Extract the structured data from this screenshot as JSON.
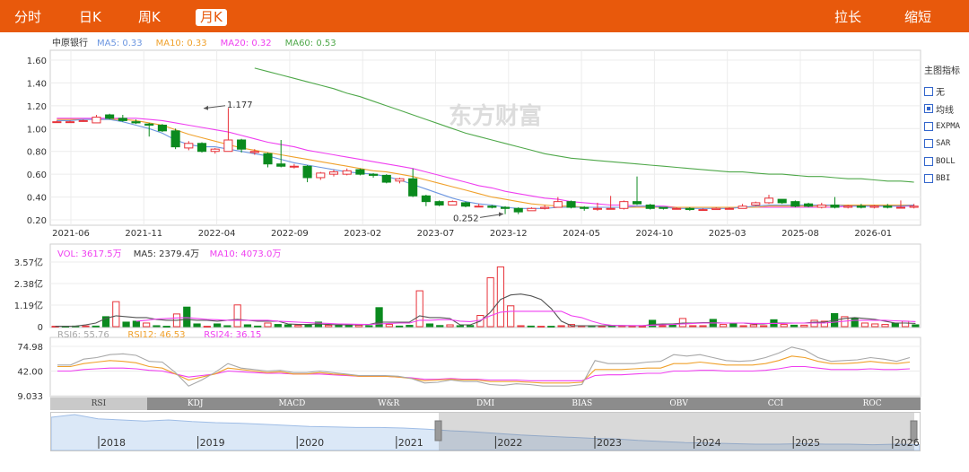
{
  "tabs": [
    {
      "label": "分时",
      "active": false
    },
    {
      "label": "日K",
      "active": false
    },
    {
      "label": "周K",
      "active": false
    },
    {
      "label": "月K",
      "active": true
    }
  ],
  "actions": {
    "stretch": "拉长",
    "shrink": "缩短"
  },
  "watermark": "东方财富",
  "indicator_panel": {
    "title": "主图指标",
    "items": [
      {
        "label": "无",
        "checked": false
      },
      {
        "label": "均线",
        "checked": true
      },
      {
        "label": "EXPMA",
        "checked": false
      },
      {
        "label": "SAR",
        "checked": false
      },
      {
        "label": "BOLL",
        "checked": false
      },
      {
        "label": "BBI",
        "checked": false
      }
    ]
  },
  "indicator_tabs": [
    {
      "label": "RSI",
      "active": true
    },
    {
      "label": "KDJ",
      "active": false
    },
    {
      "label": "MACD",
      "active": false
    },
    {
      "label": "W&R",
      "active": false
    },
    {
      "label": "DMI",
      "active": false
    },
    {
      "label": "BIAS",
      "active": false
    },
    {
      "label": "OBV",
      "active": false
    },
    {
      "label": "CCI",
      "active": false
    },
    {
      "label": "ROC",
      "active": false
    }
  ],
  "navigator": {
    "years": [
      "2018",
      "2019",
      "2020",
      "2021",
      "2022",
      "2023",
      "2024",
      "2025",
      "2026"
    ]
  },
  "colors": {
    "up": "#e8333a",
    "down": "#0a8a1e",
    "ma5": "#6c96e0",
    "ma10": "#f0a12c",
    "ma20": "#ef3ff0",
    "ma60": "#4fa84a",
    "rsi6": "#a8a8a8",
    "rsi12": "#f0a12c",
    "rsi24": "#ef3ff0",
    "brand": "#e8590c"
  },
  "chart_data": [
    {
      "type": "candlestick",
      "title": "中原银行",
      "legend": [
        {
          "name": "MA5",
          "value": "0.33",
          "color": "#6c96e0"
        },
        {
          "name": "MA10",
          "value": "0.33",
          "color": "#f0a12c"
        },
        {
          "name": "MA20",
          "value": "0.32",
          "color": "#ef3ff0"
        },
        {
          "name": "MA60",
          "value": "0.53",
          "color": "#4fa84a"
        }
      ],
      "ylim": [
        0.2,
        1.6
      ],
      "yticks": [
        "1.60",
        "1.40",
        "1.20",
        "1.00",
        "0.80",
        "0.60",
        "0.40",
        "0.20"
      ],
      "xticks": [
        "2021-06",
        "2021-11",
        "2022-04",
        "2022-09",
        "2023-02",
        "2023-07",
        "2023-12",
        "2024-05",
        "2024-10",
        "2025-03",
        "2025-08",
        "2026-01"
      ],
      "annotations": [
        {
          "text": "1.177",
          "index": 11,
          "value": 1.177
        },
        {
          "text": "0.252",
          "index": 34,
          "value": 0.252
        }
      ],
      "candles": [
        [
          1.06,
          1.06,
          1.07,
          1.05
        ],
        [
          1.06,
          1.06,
          1.07,
          1.05
        ],
        [
          1.07,
          1.07,
          1.08,
          1.06
        ],
        [
          1.05,
          1.1,
          1.12,
          1.05
        ],
        [
          1.12,
          1.09,
          1.13,
          1.08
        ],
        [
          1.09,
          1.07,
          1.12,
          1.06
        ],
        [
          1.06,
          1.05,
          1.08,
          1.04
        ],
        [
          1.04,
          1.03,
          1.05,
          0.93
        ],
        [
          1.03,
          0.98,
          1.04,
          0.97
        ],
        [
          0.98,
          0.84,
          1.0,
          0.82
        ],
        [
          0.83,
          0.87,
          0.89,
          0.81
        ],
        [
          0.87,
          0.8,
          0.88,
          0.79
        ],
        [
          0.8,
          0.82,
          0.83,
          0.78
        ],
        [
          0.8,
          0.9,
          1.18,
          0.8
        ],
        [
          0.9,
          0.82,
          0.91,
          0.79
        ],
        [
          0.79,
          0.8,
          0.82,
          0.77
        ],
        [
          0.78,
          0.69,
          0.79,
          0.66
        ],
        [
          0.69,
          0.67,
          0.9,
          0.66
        ],
        [
          0.67,
          0.67,
          0.69,
          0.65
        ],
        [
          0.67,
          0.57,
          0.68,
          0.53
        ],
        [
          0.57,
          0.61,
          0.62,
          0.55
        ],
        [
          0.6,
          0.62,
          0.64,
          0.58
        ],
        [
          0.6,
          0.63,
          0.65,
          0.59
        ],
        [
          0.64,
          0.6,
          0.65,
          0.59
        ],
        [
          0.6,
          0.59,
          0.61,
          0.57
        ],
        [
          0.59,
          0.53,
          0.6,
          0.52
        ],
        [
          0.54,
          0.56,
          0.57,
          0.52
        ],
        [
          0.56,
          0.41,
          0.65,
          0.4
        ],
        [
          0.41,
          0.36,
          0.42,
          0.32
        ],
        [
          0.36,
          0.33,
          0.37,
          0.32
        ],
        [
          0.33,
          0.36,
          0.37,
          0.33
        ],
        [
          0.35,
          0.32,
          0.36,
          0.31
        ],
        [
          0.32,
          0.32,
          0.34,
          0.31
        ],
        [
          0.32,
          0.31,
          0.33,
          0.3
        ],
        [
          0.31,
          0.3,
          0.32,
          0.25
        ],
        [
          0.3,
          0.27,
          0.31,
          0.25
        ],
        [
          0.28,
          0.3,
          0.31,
          0.28
        ],
        [
          0.3,
          0.31,
          0.33,
          0.29
        ],
        [
          0.31,
          0.36,
          0.4,
          0.31
        ],
        [
          0.36,
          0.31,
          0.37,
          0.3
        ],
        [
          0.31,
          0.3,
          0.32,
          0.28
        ],
        [
          0.3,
          0.3,
          0.35,
          0.28
        ],
        [
          0.3,
          0.3,
          0.41,
          0.29
        ],
        [
          0.3,
          0.36,
          0.37,
          0.29
        ],
        [
          0.36,
          0.34,
          0.58,
          0.33
        ],
        [
          0.33,
          0.3,
          0.34,
          0.29
        ],
        [
          0.31,
          0.3,
          0.31,
          0.29
        ],
        [
          0.3,
          0.3,
          0.31,
          0.29
        ],
        [
          0.3,
          0.29,
          0.31,
          0.28
        ],
        [
          0.29,
          0.29,
          0.3,
          0.28
        ],
        [
          0.29,
          0.3,
          0.31,
          0.29
        ],
        [
          0.3,
          0.3,
          0.31,
          0.29
        ],
        [
          0.3,
          0.32,
          0.34,
          0.3
        ],
        [
          0.33,
          0.35,
          0.36,
          0.32
        ],
        [
          0.35,
          0.39,
          0.42,
          0.34
        ],
        [
          0.38,
          0.35,
          0.36,
          0.34
        ],
        [
          0.36,
          0.32,
          0.37,
          0.31
        ],
        [
          0.34,
          0.32,
          0.35,
          0.31
        ],
        [
          0.31,
          0.33,
          0.35,
          0.3
        ],
        [
          0.33,
          0.31,
          0.4,
          0.3
        ],
        [
          0.31,
          0.32,
          0.33,
          0.3
        ],
        [
          0.32,
          0.31,
          0.34,
          0.3
        ],
        [
          0.31,
          0.32,
          0.33,
          0.3
        ],
        [
          0.32,
          0.31,
          0.34,
          0.3
        ],
        [
          0.31,
          0.31,
          0.37,
          0.3
        ],
        [
          0.31,
          0.32,
          0.34,
          0.3
        ]
      ],
      "ma5": [
        1.07,
        1.07,
        1.08,
        1.08,
        1.08,
        1.06,
        1.03,
        1.0,
        0.96,
        0.9,
        0.86,
        0.84,
        0.84,
        0.82,
        0.8,
        0.78,
        0.76,
        0.73,
        0.7,
        0.68,
        0.66,
        0.64,
        0.62,
        0.61,
        0.6,
        0.58,
        0.55,
        0.51,
        0.47,
        0.43,
        0.39,
        0.36,
        0.34,
        0.33,
        0.31,
        0.3,
        0.3,
        0.3,
        0.31,
        0.31,
        0.31,
        0.31,
        0.31,
        0.31,
        0.32,
        0.32,
        0.31,
        0.3,
        0.3,
        0.3,
        0.3,
        0.3,
        0.31,
        0.32,
        0.33,
        0.33,
        0.33,
        0.33,
        0.33,
        0.33,
        0.32,
        0.32,
        0.32,
        0.32,
        0.32,
        0.33
      ],
      "ma10": [
        1.08,
        1.08,
        1.08,
        1.08,
        1.08,
        1.08,
        1.07,
        1.05,
        1.03,
        0.99,
        0.95,
        0.92,
        0.89,
        0.86,
        0.83,
        0.81,
        0.79,
        0.77,
        0.75,
        0.73,
        0.71,
        0.69,
        0.67,
        0.65,
        0.63,
        0.62,
        0.6,
        0.58,
        0.55,
        0.52,
        0.49,
        0.46,
        0.43,
        0.4,
        0.38,
        0.36,
        0.34,
        0.33,
        0.32,
        0.32,
        0.31,
        0.31,
        0.31,
        0.31,
        0.31,
        0.31,
        0.31,
        0.31,
        0.31,
        0.31,
        0.31,
        0.31,
        0.31,
        0.31,
        0.32,
        0.32,
        0.32,
        0.32,
        0.32,
        0.33,
        0.33,
        0.33,
        0.33,
        0.33,
        0.33,
        0.33
      ],
      "ma20": [
        1.09,
        1.09,
        1.09,
        1.09,
        1.09,
        1.09,
        1.09,
        1.08,
        1.07,
        1.05,
        1.03,
        1.01,
        0.99,
        0.97,
        0.94,
        0.91,
        0.88,
        0.86,
        0.84,
        0.81,
        0.79,
        0.77,
        0.75,
        0.73,
        0.71,
        0.69,
        0.67,
        0.65,
        0.62,
        0.59,
        0.56,
        0.53,
        0.5,
        0.48,
        0.45,
        0.43,
        0.41,
        0.39,
        0.38,
        0.36,
        0.35,
        0.34,
        0.33,
        0.33,
        0.32,
        0.32,
        0.32,
        0.31,
        0.31,
        0.31,
        0.31,
        0.31,
        0.31,
        0.31,
        0.31,
        0.31,
        0.31,
        0.31,
        0.31,
        0.31,
        0.32,
        0.32,
        0.32,
        0.32,
        0.32,
        0.32
      ],
      "ma60": [
        null,
        null,
        null,
        null,
        null,
        null,
        null,
        null,
        null,
        null,
        null,
        null,
        null,
        null,
        null,
        1.53,
        1.5,
        1.47,
        1.44,
        1.41,
        1.38,
        1.35,
        1.31,
        1.28,
        1.24,
        1.2,
        1.16,
        1.12,
        1.08,
        1.04,
        1.0,
        0.96,
        0.93,
        0.9,
        0.87,
        0.84,
        0.81,
        0.78,
        0.76,
        0.74,
        0.73,
        0.72,
        0.71,
        0.7,
        0.69,
        0.68,
        0.67,
        0.66,
        0.65,
        0.64,
        0.63,
        0.62,
        0.62,
        0.61,
        0.6,
        0.6,
        0.59,
        0.58,
        0.58,
        0.57,
        0.56,
        0.56,
        0.55,
        0.54,
        0.54,
        0.53
      ]
    },
    {
      "type": "bar",
      "legend": [
        {
          "name": "VOL",
          "value": "3617.5万",
          "color": "#ef3ff0"
        },
        {
          "name": "MA5",
          "value": "2379.4万",
          "color": "#333333"
        },
        {
          "name": "MA10",
          "value": "4073.0万",
          "color": "#ef3ff0"
        }
      ],
      "yticks": [
        "3.57亿",
        "2.38亿",
        "1.19亿",
        "0"
      ],
      "ylim": [
        0,
        3.57
      ],
      "values": [
        0.02,
        0.02,
        0.03,
        0.04,
        0.03,
        0.55,
        1.38,
        0.25,
        0.3,
        0.2,
        0.05,
        0.02,
        0.7,
        1.08,
        0.15,
        0.02,
        0.15,
        0.05,
        1.2,
        0.1,
        0.03,
        0.2,
        0.12,
        0.1,
        0.08,
        0.08,
        0.25,
        0.08,
        0.1,
        0.05,
        0.08,
        0.05,
        1.05,
        0.12,
        0.03,
        0.07,
        1.98,
        0.15,
        0.06,
        0.1,
        0.05,
        0.06,
        0.62,
        2.7,
        3.3,
        1.15,
        0.05,
        0.03,
        0.02,
        0.02,
        0.05,
        0.12,
        0.04,
        0.05,
        0.03,
        0.05,
        0.04,
        0.03,
        0.02,
        0.35,
        0.05,
        0.1,
        0.45,
        0.05,
        0.05,
        0.4,
        0.12,
        0.18,
        0.05,
        0.1,
        0.05,
        0.38,
        0.12,
        0.08,
        0.08,
        0.35,
        0.3,
        0.72,
        0.55,
        0.45,
        0.2,
        0.15,
        0.12,
        0.2,
        0.3,
        0.1
      ],
      "ma5": [
        0.02,
        0.02,
        0.03,
        0.1,
        0.2,
        0.45,
        0.6,
        0.55,
        0.5,
        0.5,
        0.4,
        0.35,
        0.35,
        0.4,
        0.35,
        0.35,
        0.3,
        0.35,
        0.4,
        0.35,
        0.3,
        0.3,
        0.3,
        0.15,
        0.12,
        0.12,
        0.15,
        0.12,
        0.1,
        0.1,
        0.1,
        0.12,
        0.25,
        0.25,
        0.25,
        0.25,
        0.6,
        0.5,
        0.5,
        0.45,
        0.1,
        0.1,
        0.3,
        0.8,
        1.5,
        1.75,
        1.8,
        1.7,
        1.5,
        1.0,
        0.3,
        0.05,
        0.05,
        0.05,
        0.05,
        0.06,
        0.06,
        0.05,
        0.05,
        0.12,
        0.15,
        0.15,
        0.2,
        0.2,
        0.22,
        0.22,
        0.2,
        0.2,
        0.2,
        0.15,
        0.15,
        0.2,
        0.2,
        0.2,
        0.2,
        0.25,
        0.25,
        0.35,
        0.45,
        0.5,
        0.45,
        0.4,
        0.3,
        0.2,
        0.2,
        0.18
      ],
      "ma10": [
        null,
        null,
        null,
        null,
        null,
        null,
        null,
        null,
        0.3,
        0.35,
        0.42,
        0.45,
        0.48,
        0.5,
        0.45,
        0.4,
        0.38,
        0.35,
        0.35,
        0.35,
        0.35,
        0.35,
        0.3,
        0.28,
        0.25,
        0.22,
        0.2,
        0.18,
        0.15,
        0.14,
        0.13,
        0.12,
        0.15,
        0.18,
        0.2,
        0.2,
        0.35,
        0.35,
        0.38,
        0.38,
        0.3,
        0.28,
        0.35,
        0.6,
        0.8,
        0.85,
        0.85,
        0.85,
        0.85,
        0.85,
        0.85,
        0.6,
        0.5,
        0.3,
        0.15,
        0.07,
        0.06,
        0.06,
        0.06,
        0.08,
        0.1,
        0.12,
        0.15,
        0.18,
        0.2,
        0.2,
        0.2,
        0.2,
        0.2,
        0.18,
        0.18,
        0.18,
        0.18,
        0.2,
        0.2,
        0.2,
        0.2,
        0.25,
        0.3,
        0.35,
        0.35,
        0.35,
        0.35,
        0.32,
        0.3,
        0.28
      ]
    },
    {
      "type": "line",
      "legend": [
        {
          "name": "RSI6",
          "value": "55.76",
          "color": "#a8a8a8"
        },
        {
          "name": "RSI12",
          "value": "46.53",
          "color": "#f0a12c"
        },
        {
          "name": "RSI24",
          "value": "36.15",
          "color": "#ef3ff0"
        }
      ],
      "yticks": [
        "74.98",
        "42.00",
        "9.033"
      ],
      "ylim": [
        9.033,
        74.98
      ],
      "rsi6": [
        50,
        50,
        58,
        60,
        64,
        65,
        63,
        55,
        54,
        40,
        22,
        30,
        40,
        52,
        46,
        44,
        42,
        43,
        40,
        40,
        42,
        40,
        38,
        36,
        36,
        36,
        35,
        32,
        26,
        27,
        30,
        28,
        28,
        24,
        23,
        25,
        24,
        22,
        22,
        22,
        24,
        56,
        52,
        52,
        52,
        54,
        55,
        64,
        62,
        64,
        60,
        56,
        55,
        56,
        60,
        66,
        74,
        70,
        60,
        55,
        56,
        57,
        60,
        58,
        55,
        60
      ],
      "rsi12": [
        48,
        48,
        52,
        54,
        56,
        55,
        53,
        48,
        46,
        38,
        30,
        34,
        38,
        46,
        44,
        42,
        40,
        41,
        38,
        38,
        40,
        38,
        37,
        35,
        35,
        35,
        34,
        32,
        29,
        30,
        31,
        30,
        30,
        28,
        28,
        28,
        27,
        26,
        26,
        26,
        27,
        44,
        44,
        44,
        45,
        46,
        46,
        52,
        52,
        54,
        52,
        50,
        50,
        50,
        52,
        56,
        62,
        60,
        55,
        52,
        52,
        53,
        55,
        53,
        52,
        54
      ],
      "rsi24": [
        42,
        42,
        44,
        45,
        46,
        46,
        45,
        43,
        42,
        38,
        34,
        36,
        38,
        42,
        41,
        40,
        39,
        39,
        38,
        38,
        38,
        37,
        36,
        35,
        35,
        35,
        34,
        33,
        31,
        31,
        32,
        31,
        31,
        30,
        30,
        30,
        29,
        29,
        29,
        29,
        29,
        36,
        37,
        37,
        38,
        39,
        39,
        42,
        42,
        43,
        43,
        42,
        42,
        42,
        43,
        45,
        48,
        48,
        46,
        44,
        44,
        44,
        45,
        44,
        44,
        45
      ]
    }
  ]
}
